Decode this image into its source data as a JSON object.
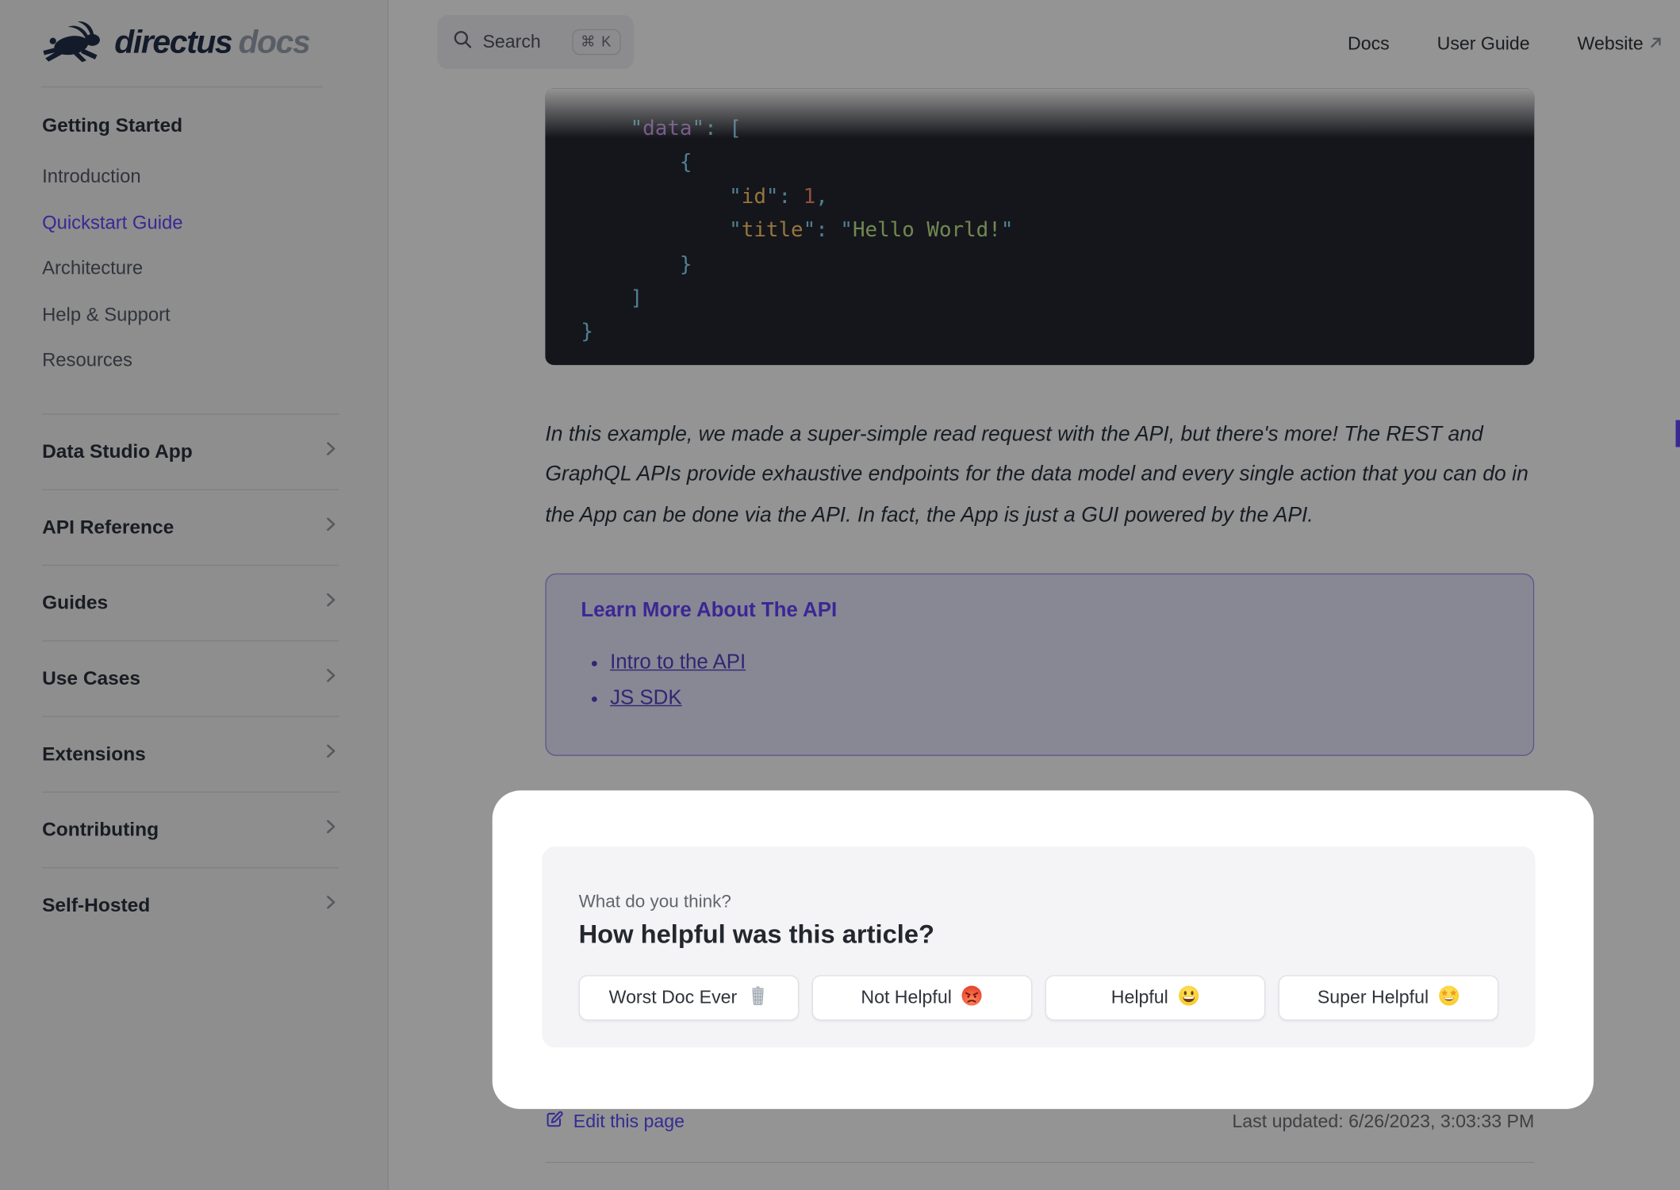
{
  "brand": {
    "logo_text": "directus",
    "logo_suffix": "docs"
  },
  "topbar": {
    "search_label": "Search",
    "search_shortcut": "⌘ K",
    "nav": [
      {
        "label": "Docs"
      },
      {
        "label": "User Guide"
      },
      {
        "label": "Website",
        "external_icon": "arrow-up-right"
      }
    ]
  },
  "sidebar": {
    "group_title": "Getting Started",
    "links": [
      {
        "label": "Introduction",
        "active": false
      },
      {
        "label": "Quickstart Guide",
        "active": true
      },
      {
        "label": "Architecture",
        "active": false
      },
      {
        "label": "Help & Support",
        "active": false
      },
      {
        "label": "Resources",
        "active": false
      }
    ],
    "sections": [
      {
        "label": "Data Studio App"
      },
      {
        "label": "API Reference"
      },
      {
        "label": "Guides"
      },
      {
        "label": "Use Cases"
      },
      {
        "label": "Extensions"
      },
      {
        "label": "Contributing"
      },
      {
        "label": "Self-Hosted"
      }
    ]
  },
  "code": {
    "language": "json",
    "lines": [
      [
        [
          "    \"",
          "p"
        ],
        [
          "data",
          "k1"
        ],
        [
          "\"",
          "p"
        ],
        [
          ": ",
          "p"
        ],
        [
          "[",
          "p"
        ]
      ],
      [
        [
          "        {",
          "p"
        ]
      ],
      [
        [
          "            \"",
          "p"
        ],
        [
          "id",
          "k2"
        ],
        [
          "\"",
          "p"
        ],
        [
          ": ",
          "p"
        ],
        [
          "1",
          "num"
        ],
        [
          ",",
          "p"
        ]
      ],
      [
        [
          "            \"",
          "p"
        ],
        [
          "title",
          "k2"
        ],
        [
          "\"",
          "p"
        ],
        [
          ": ",
          "p"
        ],
        [
          "\"",
          "p"
        ],
        [
          "Hello World!",
          "str"
        ],
        [
          "\"",
          "p"
        ]
      ],
      [
        [
          "        }",
          "p"
        ]
      ],
      [
        [
          "    ]",
          "p"
        ]
      ],
      [
        [
          "}",
          "p"
        ]
      ]
    ]
  },
  "article": {
    "paragraph": "In this example, we made a super-simple read request with the API, but there's more! The REST and GraphQL APIs provide exhaustive endpoints for the data model and every single action that you can do in the App can be done via the API. In fact, the App is just a GUI powered by the API."
  },
  "learn_more": {
    "title": "Learn More About The API",
    "links": [
      {
        "label": "Intro to the API"
      },
      {
        "label": "JS SDK"
      }
    ]
  },
  "feedback": {
    "kicker": "What do you think?",
    "title": "How helpful was this article?",
    "buttons": [
      {
        "label": "Worst Doc Ever",
        "emoji": "🗑️"
      },
      {
        "label": "Not Helpful",
        "emoji": "😡"
      },
      {
        "label": "Helpful",
        "emoji": "😃"
      },
      {
        "label": "Super Helpful",
        "emoji": "🤩"
      }
    ]
  },
  "footer": {
    "edit_link": "Edit this page",
    "last_updated": "Last updated: 6/26/2023, 3:03:33 PM"
  },
  "colors": {
    "brand": "#6644ff",
    "overlay": "rgba(0,0,0,0.42)",
    "sidebar_bg": "#f4f4f5",
    "code_bg": "#25262f",
    "learn_box_bg": "#ebe8ff",
    "card_bg": "#f4f4f6",
    "syntax": {
      "punctuation": "#89ddff",
      "key_outer": "#c792ea",
      "key_inner": "#ffcb6b",
      "number": "#f78c6c",
      "string": "#c3e88d"
    }
  }
}
